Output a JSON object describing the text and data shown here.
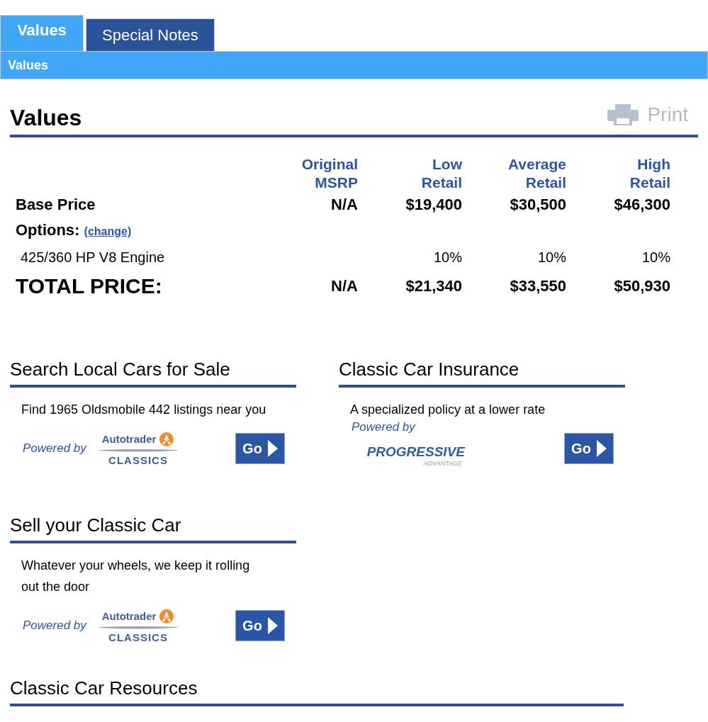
{
  "tabs": [
    {
      "label": "Values",
      "selected": true
    },
    {
      "label": "Special Notes",
      "selected": false
    }
  ],
  "subheader": "Values",
  "section_title": "Values",
  "print_label": "Print",
  "price_table": {
    "columns": [
      [
        "Original",
        "MSRP"
      ],
      [
        "Low",
        "Retail"
      ],
      [
        "Average",
        "Retail"
      ],
      [
        "High",
        "Retail"
      ]
    ],
    "rows": [
      {
        "kind": "base",
        "label": "Base Price",
        "cells": [
          "N/A",
          "$19,400",
          "$30,500",
          "$46,300"
        ]
      },
      {
        "kind": "options_header",
        "label": "Options:",
        "link": "(change)"
      },
      {
        "kind": "option",
        "label": "425/360 HP V8 Engine",
        "cells": [
          "10%",
          "10%",
          "10%"
        ]
      },
      {
        "kind": "total",
        "label": "TOTAL PRICE:",
        "cells": [
          "N/A",
          "$21,340",
          "$33,550",
          "$50,930"
        ]
      }
    ]
  },
  "panels": [
    {
      "title": "Search Local Cars for Sale",
      "lines": [
        "Find 1965 Oldsmobile 442 listings near you"
      ],
      "powered_by": "Powered by",
      "partner": {
        "kind": "autotrader",
        "name": "Autotrader",
        "sub": "CLASSICS"
      },
      "button": "Go"
    },
    {
      "title": "Classic Car Insurance",
      "lines": [
        "A specialized policy at a lower rate"
      ],
      "powered_by": "Powered by",
      "partner": {
        "kind": "progressive",
        "name": "PROGRESSIVE",
        "sub": "ADVANTAGE"
      },
      "button": "Go"
    },
    {
      "title": "Sell your Classic Car",
      "lines": [
        "Whatever your wheels, we keep it rolling",
        "out the door"
      ],
      "powered_by": "Powered by",
      "partner": {
        "kind": "autotrader",
        "name": "Autotrader",
        "sub": "CLASSICS"
      },
      "button": "Go"
    }
  ],
  "resources_title": "Classic Car Resources"
}
